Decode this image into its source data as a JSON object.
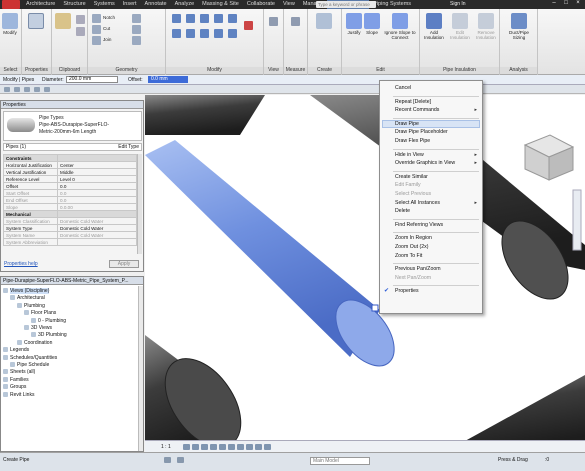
{
  "titlebar": {
    "tabs": [
      "Architecture",
      "Structure",
      "Systems",
      "Insert",
      "Annotate",
      "Analyze",
      "Massing & Site",
      "Collaborate",
      "View",
      "Manage",
      "Modify | Pipes",
      "Piping Systems"
    ],
    "active_tab": "Modify | Pipes",
    "search_placeholder": "Type a keyword or phrase",
    "sign_in": "Sign In"
  },
  "ribbon": {
    "select": {
      "modify": "Modify",
      "label": "Select"
    },
    "properties": {
      "label": "Properties"
    },
    "clipboard": {
      "paste": "Paste",
      "label": "Clipboard"
    },
    "geometry": {
      "notch": "Notch",
      "cut": "Cut",
      "join": "Join",
      "label": "Geometry"
    },
    "modify_label": "Modify",
    "view_label": "View",
    "measure_label": "Measure",
    "create_label": "Create",
    "edit": {
      "justify": "Justify",
      "slope": "Slope",
      "ignore_slope": "Ignore Slope to Connect",
      "label": "Edit"
    },
    "insulation": {
      "add": "Add Insulation",
      "edit": "Edit Insulation",
      "remove": "Remove Insulation",
      "label": "Pipe Insulation"
    },
    "analysis": {
      "duct_sizing": "Duct/Pipe Sizing",
      "label": "Analysis"
    }
  },
  "optbar": {
    "context": "Modify | Pipes",
    "diameter_label": "Diameter:",
    "diameter_value": "200.0 mm",
    "offset_label": "Offset:",
    "offset_value": "0.0 mm"
  },
  "properties": {
    "title": "Properties",
    "type_line1": "Pipe Types",
    "type_line2": "Pipe-ABS-Durapipe-SuperFLO-",
    "type_line3": "Metric-200mm-6m Length",
    "selector": "Pipes (1)",
    "edit_type": "Edit Type",
    "rows": [
      {
        "k": "Constraints",
        "v": "",
        "kind": "sec"
      },
      {
        "k": "Horizontal Justification",
        "v": "Center",
        "kind": ""
      },
      {
        "k": "Vertical Justification",
        "v": "Middle",
        "kind": ""
      },
      {
        "k": "Reference Level",
        "v": "Level 0",
        "kind": ""
      },
      {
        "k": "Offset",
        "v": "0.0",
        "kind": ""
      },
      {
        "k": "Start Offset",
        "v": "0.0",
        "kind": "grey"
      },
      {
        "k": "End Offset",
        "v": "0.0",
        "kind": "grey"
      },
      {
        "k": "Slope",
        "v": "0.0.00",
        "kind": "grey"
      },
      {
        "k": "Mechanical",
        "v": "",
        "kind": "sec"
      },
      {
        "k": "System Classification",
        "v": "Domestic Cold Water",
        "kind": "grey"
      },
      {
        "k": "System Type",
        "v": "Domestic Cold Water",
        "kind": ""
      },
      {
        "k": "System Name",
        "v": "Domestic Cold Water",
        "kind": "grey"
      },
      {
        "k": "System Abbreviation",
        "v": "",
        "kind": "grey"
      }
    ],
    "help": "Properties help",
    "apply": "Apply"
  },
  "browser": {
    "title": "Pipe-Durapipe-SuperFLO-ABS-Metric_Pipe_System_P...",
    "nodes": [
      {
        "t": "Views (Discipline)",
        "d": 0,
        "hl": true
      },
      {
        "t": "Architectural",
        "d": 1,
        "hl": false
      },
      {
        "t": "Plumbing",
        "d": 2,
        "hl": false
      },
      {
        "t": "Floor Plans",
        "d": 3,
        "hl": false
      },
      {
        "t": "0 - Plumbing",
        "d": 4,
        "hl": false
      },
      {
        "t": "3D Views",
        "d": 3,
        "hl": false
      },
      {
        "t": "3D Plumbing",
        "d": 4,
        "hl": false
      },
      {
        "t": "Coordination",
        "d": 2,
        "hl": false
      },
      {
        "t": "Legends",
        "d": 0,
        "hl": false
      },
      {
        "t": "Schedules/Quantities",
        "d": 0,
        "hl": false
      },
      {
        "t": "Pipe Schedule",
        "d": 1,
        "hl": false
      },
      {
        "t": "Sheets (all)",
        "d": 0,
        "hl": false
      },
      {
        "t": "Families",
        "d": 0,
        "hl": false
      },
      {
        "t": "Groups",
        "d": 0,
        "hl": false
      },
      {
        "t": "Revit Links",
        "d": 0,
        "hl": false
      }
    ]
  },
  "viewctl": {
    "scale": "1 : 1"
  },
  "context_menu": {
    "items": [
      {
        "label": "Cancel",
        "kind": "",
        "arrow": false,
        "checked": false
      },
      {
        "label": "",
        "kind": "sep",
        "arrow": false,
        "checked": false
      },
      {
        "label": "Repeat [Delete]",
        "kind": "",
        "arrow": false,
        "checked": false
      },
      {
        "label": "Recent Commands",
        "kind": "",
        "arrow": true,
        "checked": false
      },
      {
        "label": "",
        "kind": "sep",
        "arrow": false,
        "checked": false
      },
      {
        "label": "Draw Pipe",
        "kind": "hl",
        "arrow": false,
        "checked": false
      },
      {
        "label": "Draw Pipe Placeholder",
        "kind": "",
        "arrow": false,
        "checked": false
      },
      {
        "label": "Draw Flex Pipe",
        "kind": "",
        "arrow": false,
        "checked": false
      },
      {
        "label": "",
        "kind": "sep",
        "arrow": false,
        "checked": false
      },
      {
        "label": "Hide in View",
        "kind": "",
        "arrow": true,
        "checked": false
      },
      {
        "label": "Override Graphics in View",
        "kind": "",
        "arrow": true,
        "checked": false
      },
      {
        "label": "",
        "kind": "sep",
        "arrow": false,
        "checked": false
      },
      {
        "label": "Create Similar",
        "kind": "",
        "arrow": false,
        "checked": false
      },
      {
        "label": "Edit Family",
        "kind": "dis",
        "arrow": false,
        "checked": false
      },
      {
        "label": "Select Previous",
        "kind": "dis",
        "arrow": false,
        "checked": false
      },
      {
        "label": "Select All Instances",
        "kind": "",
        "arrow": true,
        "checked": false
      },
      {
        "label": "Delete",
        "kind": "",
        "arrow": false,
        "checked": false
      },
      {
        "label": "",
        "kind": "sep",
        "arrow": false,
        "checked": false
      },
      {
        "label": "Find Referring Views",
        "kind": "",
        "arrow": false,
        "checked": false
      },
      {
        "label": "",
        "kind": "sep",
        "arrow": false,
        "checked": false
      },
      {
        "label": "Zoom In Region",
        "kind": "",
        "arrow": false,
        "checked": false
      },
      {
        "label": "Zoom Out (2x)",
        "kind": "",
        "arrow": false,
        "checked": false
      },
      {
        "label": "Zoom To Fit",
        "kind": "",
        "arrow": false,
        "checked": false
      },
      {
        "label": "",
        "kind": "sep",
        "arrow": false,
        "checked": false
      },
      {
        "label": "Previous Pan/Zoom",
        "kind": "",
        "arrow": false,
        "checked": false
      },
      {
        "label": "Next Pan/Zoom",
        "kind": "dis",
        "arrow": false,
        "checked": false
      },
      {
        "label": "",
        "kind": "sep",
        "arrow": false,
        "checked": false
      },
      {
        "label": "Properties",
        "kind": "",
        "arrow": false,
        "checked": true
      }
    ]
  },
  "statusbar": {
    "message": "Create Pipe",
    "model": "Main Model",
    "press_drag": "Press & Drag",
    "filter_count": ":0"
  },
  "colors": {
    "selected_pipe": "#7f9ee6",
    "pipe_dark": "#3a3a3a",
    "active_tab": "#5b7aa8"
  }
}
